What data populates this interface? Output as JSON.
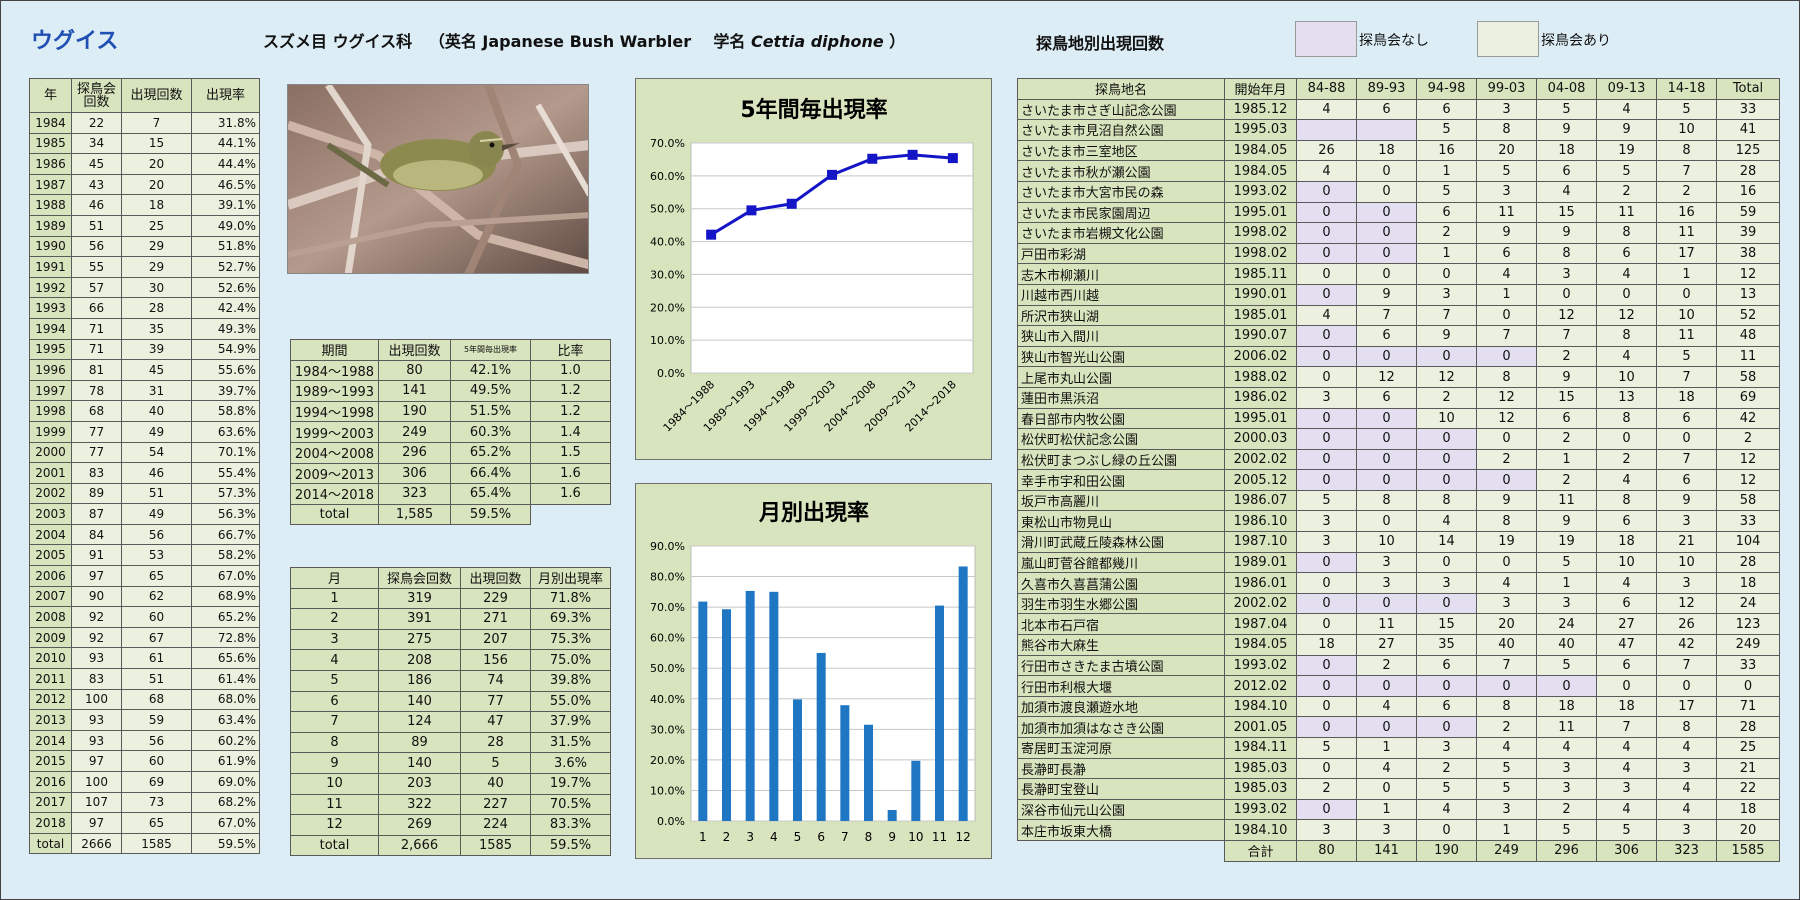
{
  "header": {
    "title": "ウグイス",
    "order_family": "スズメ目 ウグイス科",
    "english_prefix": "（英名 ",
    "english_name": "Japanese Bush Warbler",
    "sci_prefix": "学名 ",
    "sci_name": "Cettia diphone",
    "sci_suffix": " ）",
    "right_title": "探鳥地別出現回数",
    "legend_none": "探鳥会なし",
    "legend_yes": "探鳥会あり"
  },
  "colors": {
    "tan": "#d7e4bd",
    "light_green": "#ebf1de",
    "lavender": "#e3dff0",
    "bar": "#1f77c4",
    "line": "#1515c8",
    "title": "#1f4fb2"
  },
  "year_table": {
    "headers": [
      "年",
      "探鳥会\n回数",
      "出現回数",
      "出現率"
    ],
    "rows": [
      [
        "1984",
        "22",
        "7",
        "31.8%"
      ],
      [
        "1985",
        "34",
        "15",
        "44.1%"
      ],
      [
        "1986",
        "45",
        "20",
        "44.4%"
      ],
      [
        "1987",
        "43",
        "20",
        "46.5%"
      ],
      [
        "1988",
        "46",
        "18",
        "39.1%"
      ],
      [
        "1989",
        "51",
        "25",
        "49.0%"
      ],
      [
        "1990",
        "56",
        "29",
        "51.8%"
      ],
      [
        "1991",
        "55",
        "29",
        "52.7%"
      ],
      [
        "1992",
        "57",
        "30",
        "52.6%"
      ],
      [
        "1993",
        "66",
        "28",
        "42.4%"
      ],
      [
        "1994",
        "71",
        "35",
        "49.3%"
      ],
      [
        "1995",
        "71",
        "39",
        "54.9%"
      ],
      [
        "1996",
        "81",
        "45",
        "55.6%"
      ],
      [
        "1997",
        "78",
        "31",
        "39.7%"
      ],
      [
        "1998",
        "68",
        "40",
        "58.8%"
      ],
      [
        "1999",
        "77",
        "49",
        "63.6%"
      ],
      [
        "2000",
        "77",
        "54",
        "70.1%"
      ],
      [
        "2001",
        "83",
        "46",
        "55.4%"
      ],
      [
        "2002",
        "89",
        "51",
        "57.3%"
      ],
      [
        "2003",
        "87",
        "49",
        "56.3%"
      ],
      [
        "2004",
        "84",
        "56",
        "66.7%"
      ],
      [
        "2005",
        "91",
        "53",
        "58.2%"
      ],
      [
        "2006",
        "97",
        "65",
        "67.0%"
      ],
      [
        "2007",
        "90",
        "62",
        "68.9%"
      ],
      [
        "2008",
        "92",
        "60",
        "65.2%"
      ],
      [
        "2009",
        "92",
        "67",
        "72.8%"
      ],
      [
        "2010",
        "93",
        "61",
        "65.6%"
      ],
      [
        "2011",
        "83",
        "51",
        "61.4%"
      ],
      [
        "2012",
        "100",
        "68",
        "68.0%"
      ],
      [
        "2013",
        "93",
        "59",
        "63.4%"
      ],
      [
        "2014",
        "93",
        "56",
        "60.2%"
      ],
      [
        "2015",
        "97",
        "60",
        "61.9%"
      ],
      [
        "2016",
        "100",
        "69",
        "69.0%"
      ],
      [
        "2017",
        "107",
        "73",
        "68.2%"
      ],
      [
        "2018",
        "97",
        "65",
        "67.0%"
      ],
      [
        "total",
        "2666",
        "1585",
        "59.5%"
      ]
    ]
  },
  "period_table": {
    "headers": [
      "期間",
      "出現回数",
      "5年間毎出現率",
      "比率"
    ],
    "rows": [
      [
        "1984～1988",
        "80",
        "42.1%",
        "1.0"
      ],
      [
        "1989～1993",
        "141",
        "49.5%",
        "1.2"
      ],
      [
        "1994～1998",
        "190",
        "51.5%",
        "1.2"
      ],
      [
        "1999～2003",
        "249",
        "60.3%",
        "1.4"
      ],
      [
        "2004～2008",
        "296",
        "65.2%",
        "1.5"
      ],
      [
        "2009～2013",
        "306",
        "66.4%",
        "1.6"
      ],
      [
        "2014～2018",
        "323",
        "65.4%",
        "1.6"
      ]
    ],
    "total": [
      "total",
      "1,585",
      "59.5%"
    ]
  },
  "month_table": {
    "headers": [
      "月",
      "探鳥会回数",
      "出現回数",
      "月別出現率"
    ],
    "rows": [
      [
        "1",
        "319",
        "229",
        "71.8%"
      ],
      [
        "2",
        "391",
        "271",
        "69.3%"
      ],
      [
        "3",
        "275",
        "207",
        "75.3%"
      ],
      [
        "4",
        "208",
        "156",
        "75.0%"
      ],
      [
        "5",
        "186",
        "74",
        "39.8%"
      ],
      [
        "6",
        "140",
        "77",
        "55.0%"
      ],
      [
        "7",
        "124",
        "47",
        "37.9%"
      ],
      [
        "8",
        "89",
        "28",
        "31.5%"
      ],
      [
        "9",
        "140",
        "5",
        "3.6%"
      ],
      [
        "10",
        "203",
        "40",
        "19.7%"
      ],
      [
        "11",
        "322",
        "227",
        "70.5%"
      ],
      [
        "12",
        "269",
        "224",
        "83.3%"
      ],
      [
        "total",
        "2,666",
        "1585",
        "59.5%"
      ]
    ]
  },
  "site_table": {
    "headers": [
      "探鳥地名",
      "開始年月",
      "84-88",
      "89-93",
      "94-98",
      "99-03",
      "04-08",
      "09-13",
      "14-18",
      "Total"
    ],
    "rows": [
      [
        "さいたま市さぎ山記念公園",
        "1985.12",
        "4",
        "6",
        "6",
        "3",
        "5",
        "4",
        "5",
        "33"
      ],
      [
        "さいたま市見沼自然公園",
        "1995.03",
        "",
        "",
        "5",
        "8",
        "9",
        "9",
        "10",
        "41"
      ],
      [
        "さいたま市三室地区",
        "1984.05",
        "26",
        "18",
        "16",
        "20",
        "18",
        "19",
        "8",
        "125"
      ],
      [
        "さいたま市秋が瀬公園",
        "1984.05",
        "4",
        "0",
        "1",
        "5",
        "6",
        "5",
        "7",
        "28"
      ],
      [
        "さいたま市大宮市民の森",
        "1993.02",
        "0",
        "0",
        "5",
        "3",
        "4",
        "2",
        "2",
        "16"
      ],
      [
        "さいたま市民家園周辺",
        "1995.01",
        "0",
        "0",
        "6",
        "11",
        "15",
        "11",
        "16",
        "59"
      ],
      [
        "さいたま市岩槻文化公園",
        "1998.02",
        "0",
        "0",
        "2",
        "9",
        "9",
        "8",
        "11",
        "39"
      ],
      [
        "戸田市彩湖",
        "1998.02",
        "0",
        "0",
        "1",
        "6",
        "8",
        "6",
        "17",
        "38"
      ],
      [
        "志木市柳瀬川",
        "1985.11",
        "0",
        "0",
        "0",
        "4",
        "3",
        "4",
        "1",
        "12"
      ],
      [
        "川越市西川越",
        "1990.01",
        "0",
        "9",
        "3",
        "1",
        "0",
        "0",
        "0",
        "13"
      ],
      [
        "所沢市狭山湖",
        "1985.01",
        "4",
        "7",
        "7",
        "0",
        "12",
        "12",
        "10",
        "52"
      ],
      [
        "狭山市入間川",
        "1990.07",
        "0",
        "6",
        "9",
        "7",
        "7",
        "8",
        "11",
        "48"
      ],
      [
        "狭山市智光山公園",
        "2006.02",
        "0",
        "0",
        "0",
        "0",
        "2",
        "4",
        "5",
        "11"
      ],
      [
        "上尾市丸山公園",
        "1988.02",
        "0",
        "12",
        "12",
        "8",
        "9",
        "10",
        "7",
        "58"
      ],
      [
        "蓮田市黒浜沼",
        "1986.02",
        "3",
        "6",
        "2",
        "12",
        "15",
        "13",
        "18",
        "69"
      ],
      [
        "春日部市内牧公園",
        "1995.01",
        "0",
        "0",
        "10",
        "12",
        "6",
        "8",
        "6",
        "42"
      ],
      [
        "松伏町松伏記念公園",
        "2000.03",
        "0",
        "0",
        "0",
        "0",
        "2",
        "0",
        "0",
        "2"
      ],
      [
        "松伏町まつぶし緑の丘公園",
        "2002.02",
        "0",
        "0",
        "0",
        "2",
        "1",
        "2",
        "7",
        "12"
      ],
      [
        "幸手市宇和田公園",
        "2005.12",
        "0",
        "0",
        "0",
        "0",
        "2",
        "4",
        "6",
        "12"
      ],
      [
        "坂戸市高麗川",
        "1986.07",
        "5",
        "8",
        "8",
        "9",
        "11",
        "8",
        "9",
        "58"
      ],
      [
        "東松山市物見山",
        "1986.10",
        "3",
        "0",
        "4",
        "8",
        "9",
        "6",
        "3",
        "33"
      ],
      [
        "滑川町武蔵丘陵森林公園",
        "1987.10",
        "3",
        "10",
        "14",
        "19",
        "19",
        "18",
        "21",
        "104"
      ],
      [
        "嵐山町菅谷館都幾川",
        "1989.01",
        "0",
        "3",
        "0",
        "0",
        "5",
        "10",
        "10",
        "28"
      ],
      [
        "久喜市久喜菖蒲公園",
        "1986.01",
        "0",
        "3",
        "3",
        "4",
        "1",
        "4",
        "3",
        "18"
      ],
      [
        "羽生市羽生水郷公園",
        "2002.02",
        "0",
        "0",
        "0",
        "3",
        "3",
        "6",
        "12",
        "24"
      ],
      [
        "北本市石戸宿",
        "1987.04",
        "0",
        "11",
        "15",
        "20",
        "24",
        "27",
        "26",
        "123"
      ],
      [
        "熊谷市大麻生",
        "1984.05",
        "18",
        "27",
        "35",
        "40",
        "40",
        "47",
        "42",
        "249"
      ],
      [
        "行田市さきたま古墳公園",
        "1993.02",
        "0",
        "2",
        "6",
        "7",
        "5",
        "6",
        "7",
        "33"
      ],
      [
        "行田市利根大堰",
        "2012.02",
        "0",
        "0",
        "0",
        "0",
        "0",
        "0",
        "0",
        "0"
      ],
      [
        "加須市渡良瀬遊水地",
        "1984.10",
        "0",
        "4",
        "6",
        "8",
        "18",
        "18",
        "17",
        "71"
      ],
      [
        "加須市加須はなさき公園",
        "2001.05",
        "0",
        "0",
        "0",
        "2",
        "11",
        "7",
        "8",
        "28"
      ],
      [
        "寄居町玉淀河原",
        "1984.11",
        "5",
        "1",
        "3",
        "4",
        "4",
        "4",
        "4",
        "25"
      ],
      [
        "長瀞町長瀞",
        "1985.03",
        "0",
        "4",
        "2",
        "5",
        "3",
        "4",
        "3",
        "21"
      ],
      [
        "長瀞町宝登山",
        "1985.03",
        "2",
        "0",
        "5",
        "5",
        "3",
        "3",
        "4",
        "22"
      ],
      [
        "深谷市仙元山公園",
        "1993.02",
        "0",
        "1",
        "4",
        "3",
        "2",
        "4",
        "4",
        "18"
      ],
      [
        "本庄市坂東大橋",
        "1984.10",
        "3",
        "3",
        "0",
        "1",
        "5",
        "5",
        "3",
        "20"
      ]
    ],
    "total_label": "合計",
    "totals": [
      "80",
      "141",
      "190",
      "249",
      "296",
      "306",
      "323",
      "1585"
    ]
  },
  "chart_data": [
    {
      "type": "line",
      "title": "5年間毎出現率",
      "categories": [
        "1984～1988",
        "1989～1993",
        "1994～1998",
        "1999～2003",
        "2004～2008",
        "2009～2013",
        "2014～2018"
      ],
      "values": [
        42.1,
        49.5,
        51.5,
        60.3,
        65.2,
        66.4,
        65.4
      ],
      "ylim": [
        0,
        70
      ],
      "yticks": [
        "0.0%",
        "10.0%",
        "20.0%",
        "30.0%",
        "40.0%",
        "50.0%",
        "60.0%",
        "70.0%"
      ],
      "grid": true
    },
    {
      "type": "bar",
      "title": "月別出現率",
      "categories": [
        "1",
        "2",
        "3",
        "4",
        "5",
        "6",
        "7",
        "8",
        "9",
        "10",
        "11",
        "12"
      ],
      "values": [
        71.8,
        69.3,
        75.3,
        75.0,
        39.8,
        55.0,
        37.9,
        31.5,
        3.6,
        19.7,
        70.5,
        83.3
      ],
      "ylim": [
        0,
        90
      ],
      "yticks": [
        "0.0%",
        "10.0%",
        "20.0%",
        "30.0%",
        "40.0%",
        "50.0%",
        "60.0%",
        "70.0%",
        "80.0%",
        "90.0%"
      ],
      "grid": true
    }
  ]
}
